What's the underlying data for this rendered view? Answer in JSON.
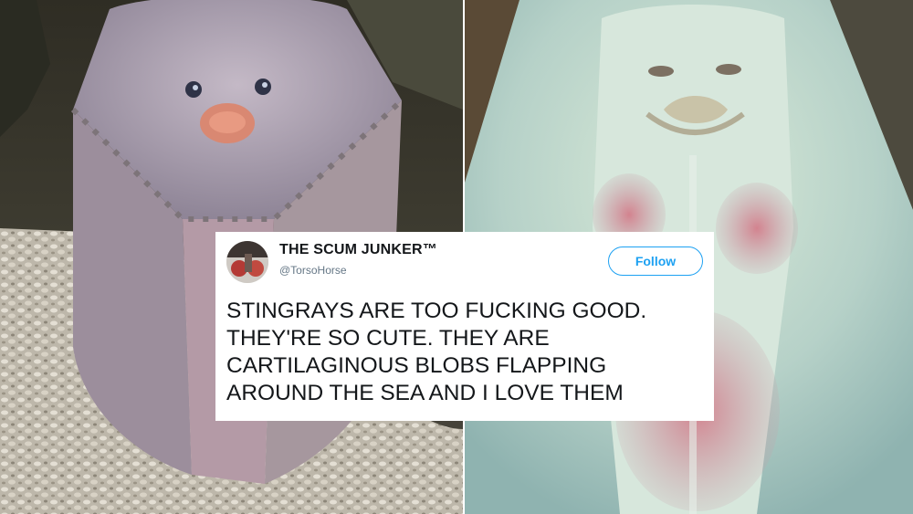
{
  "tweet": {
    "display_name": "THE SCUM JUNKER™",
    "handle": "@TorsoHorse",
    "follow_label": "Follow",
    "text_lines": [
      "STINGRAYS ARE TOO FUCKING GOOD.",
      "THEY'RE SO CUTE. THEY ARE",
      "CARTILAGINOUS BLOBS FLAPPING",
      "AROUND THE SEA AND I LOVE THEM"
    ]
  },
  "colors": {
    "accent": "#1da1f2",
    "text": "#14171a",
    "secondary_text": "#657786"
  },
  "icons": [
    "avatar-image"
  ]
}
